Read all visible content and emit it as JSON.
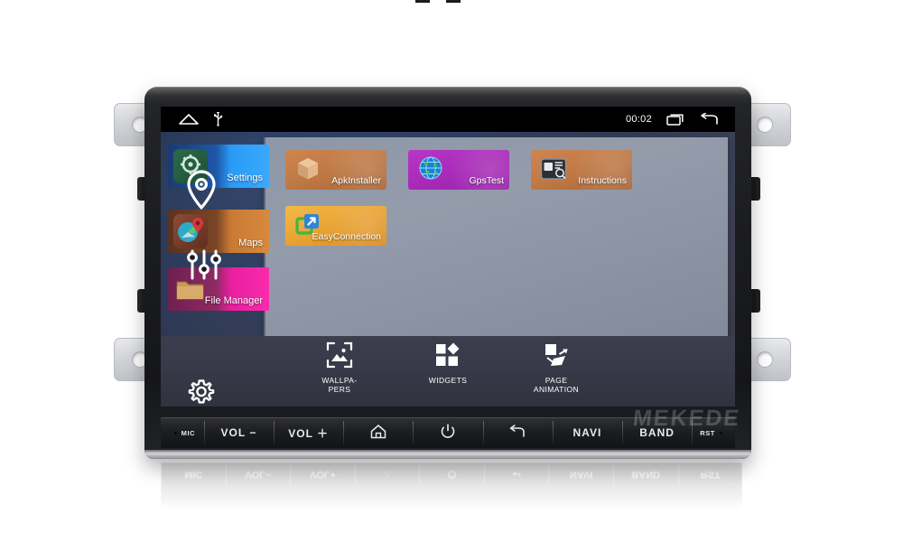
{
  "device": {
    "brand_watermark": "MEKEDE"
  },
  "statusbar": {
    "home_icon": "home-tent-icon",
    "usb_icon": "usb-icon",
    "time": "00:02",
    "recents_icon": "recent-apps-icon",
    "back_icon": "back-arrow-icon"
  },
  "widgets": [
    {
      "label": "Settings",
      "icon": "settings-widget-icon",
      "color": "#2a9bf5"
    },
    {
      "label": "Maps",
      "icon": "maps-widget-icon",
      "color": "#c97a34"
    },
    {
      "label": "File Manager",
      "icon": "folder-icon",
      "color": "#e81fa0"
    }
  ],
  "overlay_icons": [
    {
      "name": "location-pin-icon"
    },
    {
      "name": "equalizer-icon"
    },
    {
      "name": "gear-icon"
    }
  ],
  "apps": [
    {
      "label": "ApkInstaller",
      "icon": "package-box-icon",
      "color": "#c07a46"
    },
    {
      "label": "GpsTest",
      "icon": "globe-icon",
      "color": "#a82ab8"
    },
    {
      "label": "Instructions",
      "icon": "manual-book-icon",
      "color": "#c07a46"
    },
    {
      "label": "EasyConnection",
      "icon": "screen-mirror-icon",
      "color": "#e9a232"
    }
  ],
  "dock": [
    {
      "label": "WALLPA-\nPERS",
      "line1": "WALLPA-",
      "line2": "PERS",
      "icon": "wallpaper-icon"
    },
    {
      "label": "WIDGETS",
      "line1": "WIDGETS",
      "line2": "",
      "icon": "widgets-icon"
    },
    {
      "label": "PAGE ANIMATION",
      "line1": "PAGE",
      "line2": "ANIMATION",
      "icon": "page-animation-icon"
    }
  ],
  "hardware_buttons": [
    {
      "label": "MIC",
      "icon": "microphone-pinhole"
    },
    {
      "label": "VOL −",
      "icon": ""
    },
    {
      "label": "VOL ＋",
      "icon": ""
    },
    {
      "label": "",
      "icon": "home-icon"
    },
    {
      "label": "",
      "icon": "power-icon"
    },
    {
      "label": "",
      "icon": "back-icon"
    },
    {
      "label": "NAVI",
      "icon": ""
    },
    {
      "label": "BAND",
      "icon": ""
    },
    {
      "label": "RST",
      "icon": "reset-pinhole"
    }
  ]
}
